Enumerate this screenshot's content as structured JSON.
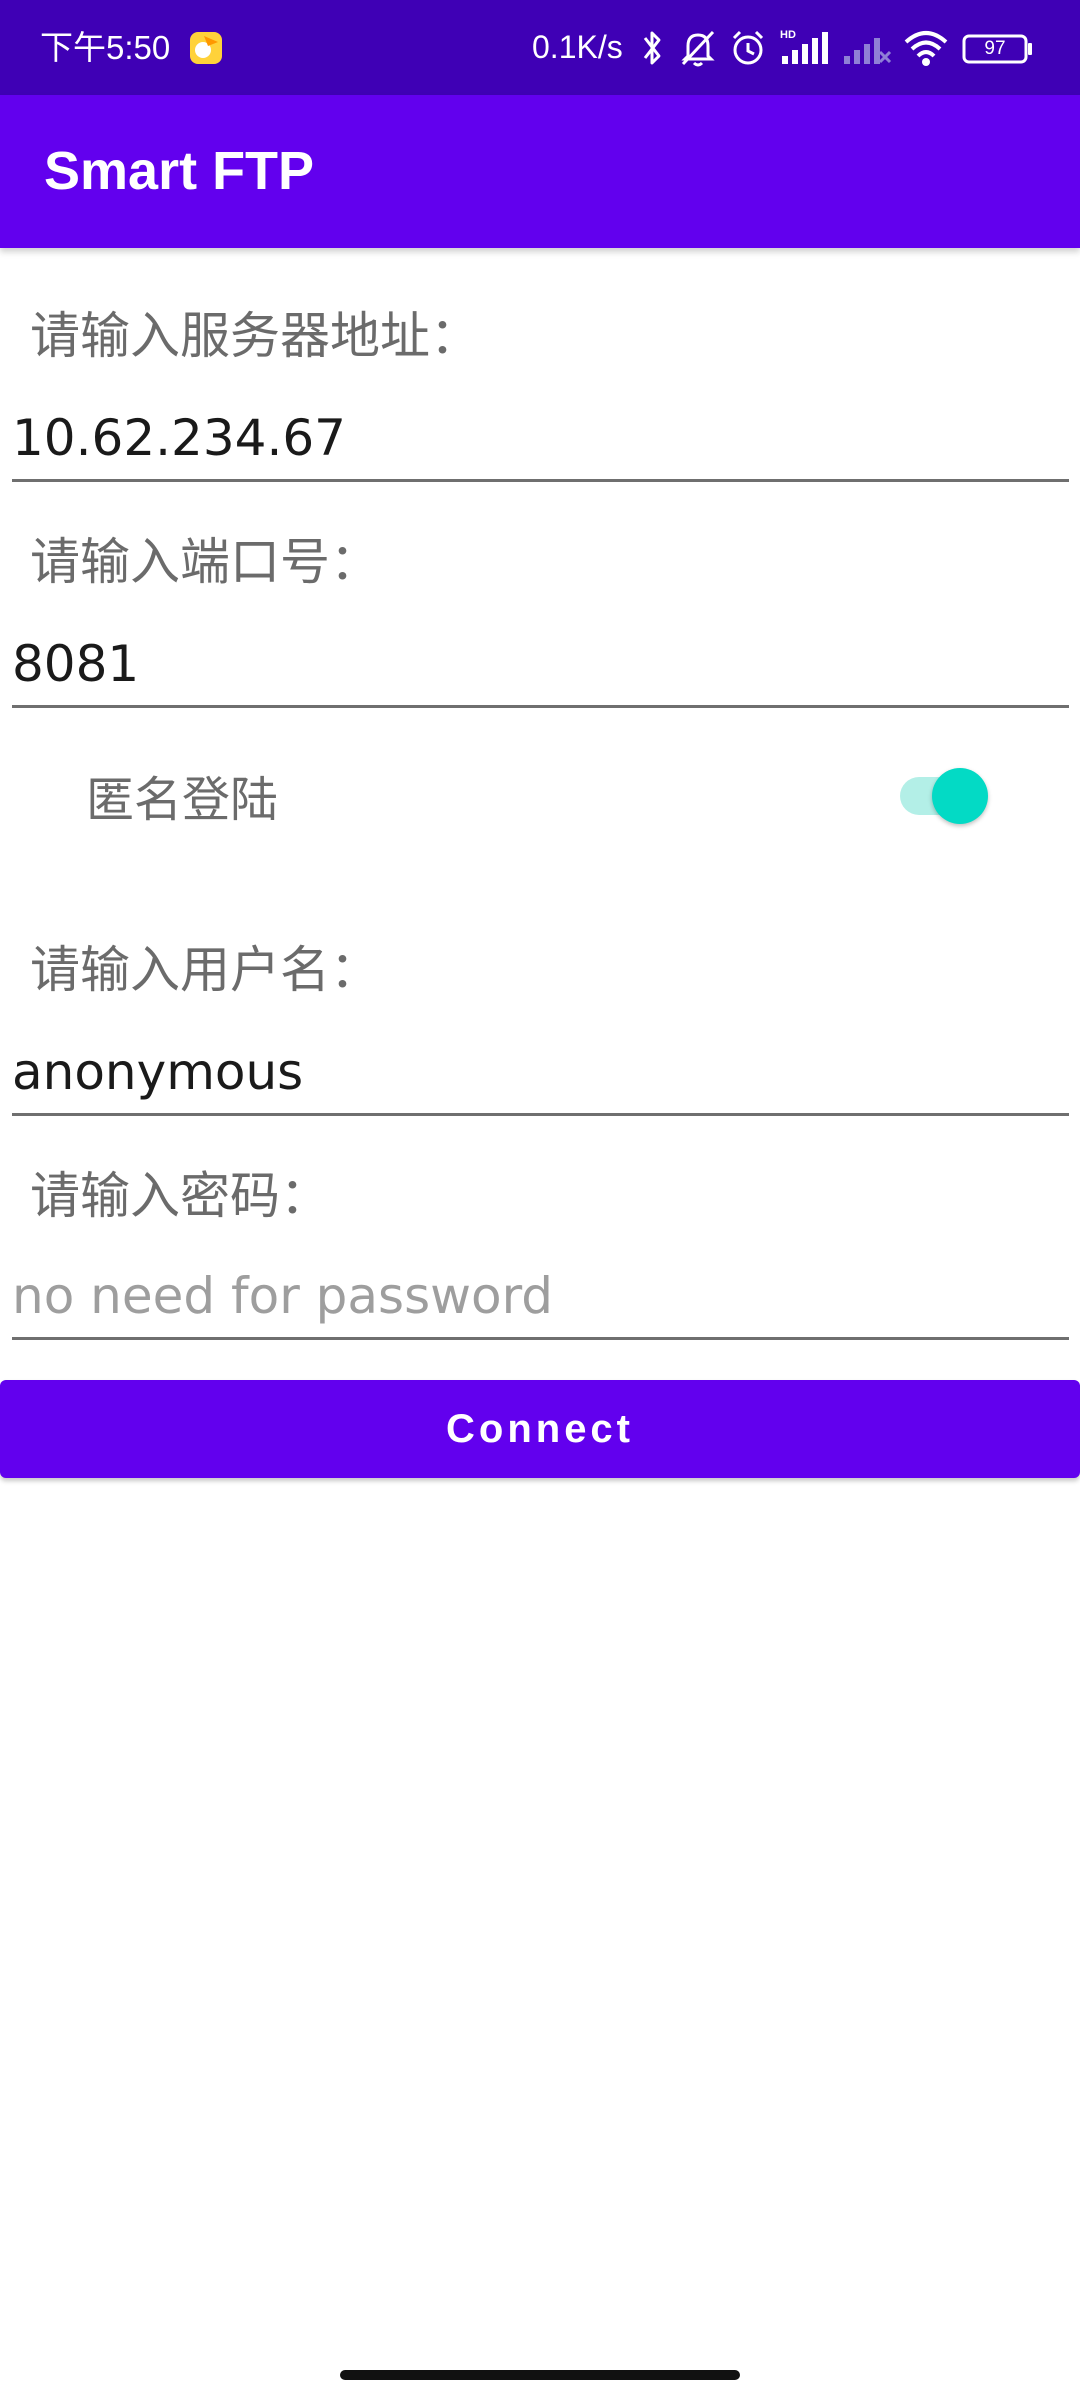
{
  "status_bar": {
    "time": "下午5:50",
    "net_speed": "0.1K/s",
    "battery_level": "97",
    "icons": [
      "app-notification-icon",
      "bluetooth-icon",
      "mute-bell-icon",
      "alarm-icon",
      "hd-signal-icon",
      "signal-weak-icon",
      "wifi-icon",
      "battery-icon"
    ]
  },
  "app_bar": {
    "title": "Smart FTP"
  },
  "form": {
    "server": {
      "label": "请输入服务器地址：",
      "value": "10.62.234.67"
    },
    "port": {
      "label": "请输入端口号：",
      "value": "8081"
    },
    "anonymous_switch": {
      "label": "匿名登陆",
      "checked": true
    },
    "username": {
      "label": "请输入用户名：",
      "value": "anonymous"
    },
    "password": {
      "label": "请输入密码：",
      "placeholder": "no need for password",
      "value": ""
    },
    "connect_label": "Connect"
  },
  "colors": {
    "status_bar": "#3f00b5",
    "primary": "#6200ee",
    "switch_accent": "#03dac5",
    "switch_track": "#b3efe7"
  }
}
